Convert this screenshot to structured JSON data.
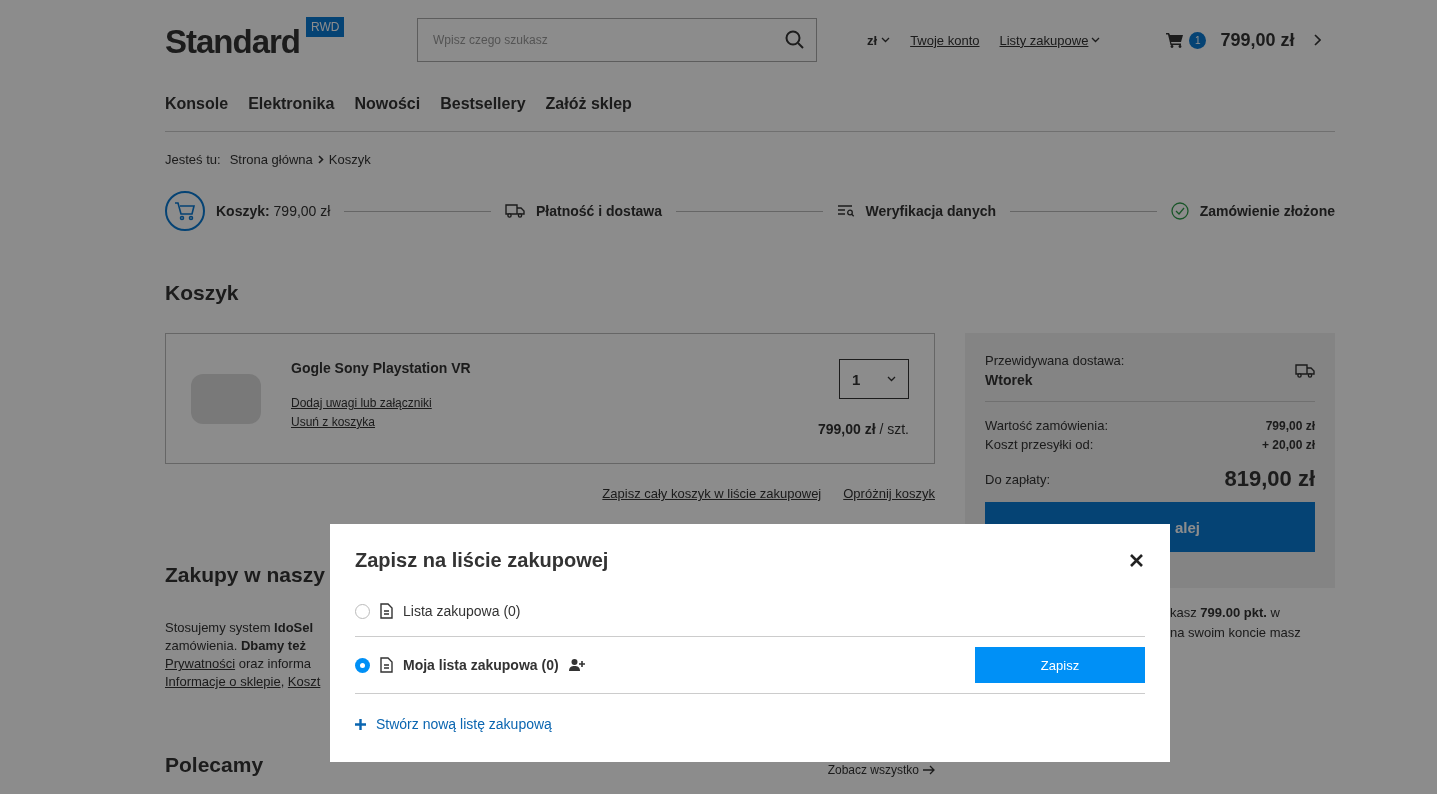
{
  "header": {
    "logo": {
      "name": "Standard",
      "badge": "RWD"
    },
    "search": {
      "placeholder": "Wpisz czego szukasz"
    },
    "currency": "zł",
    "links": [
      {
        "label": "Twoje konto",
        "dropdown": false
      },
      {
        "label": "Listy zakupowe",
        "dropdown": true
      }
    ],
    "cart": {
      "count": "1",
      "total": "799,00 zł"
    }
  },
  "nav": [
    "Konsole",
    "Elektronika",
    "Nowości",
    "Bestsellery",
    "Załóż sklep"
  ],
  "breadcrumb": {
    "label": "Jesteś tu:",
    "items": [
      "Strona główna",
      "Koszyk"
    ]
  },
  "steps": [
    {
      "kind": "cart",
      "label": "Koszyk:",
      "value": "799,00 zł",
      "current": true
    },
    {
      "kind": "delivery",
      "label": "Płatność i dostawa",
      "current": false
    },
    {
      "kind": "verify",
      "label": "Weryfikacja danych",
      "current": false
    },
    {
      "kind": "done",
      "label": "Zamówienie złożone",
      "current": false
    }
  ],
  "cart": {
    "title": "Koszyk",
    "items": [
      {
        "name": "Gogle Sony Playstation VR",
        "links": [
          "Dodaj uwagi lub załączniki",
          "Usuń z koszyka"
        ],
        "quantity": "1",
        "price": "799,00 zł",
        "unit": "/ szt."
      }
    ],
    "actions": [
      "Zapisz cały koszyk w liście zakupowej",
      "Opróżnij koszyk"
    ]
  },
  "summary": {
    "delivery_label": "Przewidywana dostawa:",
    "delivery_day": "Wtorek",
    "rows": [
      {
        "label": "Wartość zamówienia:",
        "value": "799,00 zł"
      },
      {
        "label": "Koszt przesyłki od:",
        "value": "+ 20,00 zł"
      }
    ],
    "total_label": "Do zapłaty:",
    "total_value": "819,00 zł",
    "button": "alej",
    "note_lines": [
      "kasz **799.00 pkt.** w",
      "na swoim koncie masz"
    ]
  },
  "info": {
    "title": "Zakupy w naszy",
    "lines": [
      [
        {
          "kind": "plain",
          "text": "Stosujemy system "
        },
        {
          "kind": "bold",
          "text": "IdoSel"
        }
      ],
      [
        {
          "kind": "plain",
          "text": "zamówienia. "
        },
        {
          "kind": "bold",
          "text": "Dbamy też"
        }
      ],
      [
        {
          "kind": "link",
          "text": "Prywatności"
        },
        {
          "kind": "plain",
          "text": " oraz informa"
        }
      ],
      [
        {
          "kind": "link",
          "text": "Informacje o sklepie"
        },
        {
          "kind": "plain",
          "text": ", "
        },
        {
          "kind": "link",
          "text": "Koszt"
        }
      ]
    ]
  },
  "recommended": {
    "title": "Polecamy",
    "link": "Zobacz wszystko"
  },
  "modal": {
    "title": "Zapisz na liście zakupowej",
    "lists": [
      {
        "label": "Lista zakupowa (0)",
        "selected": false,
        "shared": false
      },
      {
        "label": "Moja lista zakupowa (0)",
        "selected": true,
        "shared": true
      }
    ],
    "save_button": "Zapisz",
    "create_link": "Stwórz nową listę zakupową"
  }
}
